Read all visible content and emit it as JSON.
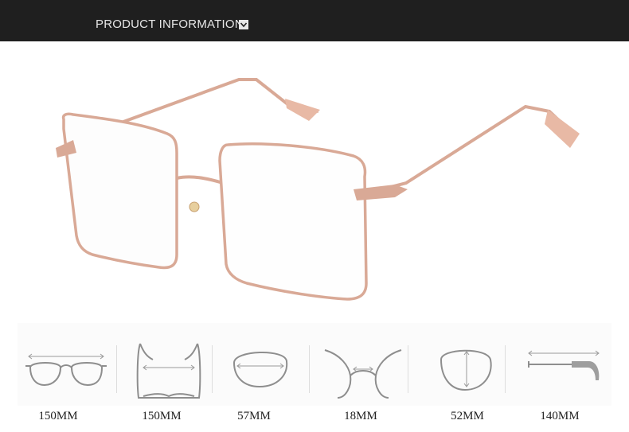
{
  "header": {
    "title": "PRODUCT INFORMATION",
    "toggle_icon": "chevron-down-icon"
  },
  "colors": {
    "header_bg": "#1f1f1f",
    "frame_gold": "#d9a996",
    "diagram_gray": "#8e8e8e",
    "arrow_gray": "#9a9a9a"
  },
  "measurements": [
    {
      "icon": "total-width-icon",
      "value": "150MM"
    },
    {
      "icon": "front-width-icon",
      "value": "150MM"
    },
    {
      "icon": "lens-width-icon",
      "value": "57MM"
    },
    {
      "icon": "bridge-width-icon",
      "value": "18MM"
    },
    {
      "icon": "lens-height-icon",
      "value": "52MM"
    },
    {
      "icon": "temple-length-icon",
      "value": "140MM"
    }
  ]
}
